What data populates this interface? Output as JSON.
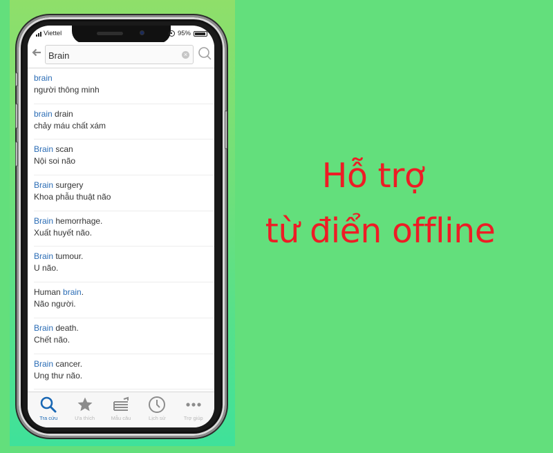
{
  "status_bar": {
    "carrier": "Viettel",
    "battery": "95%",
    "battery_level": 0.95
  },
  "search": {
    "value": "Brain",
    "placeholder": "",
    "back_icon": "arrow-left-icon",
    "clear_icon": "clear-circle-icon",
    "search_icon": "magnifier-icon"
  },
  "results": [
    {
      "pre": "",
      "hl": "brain",
      "post": "",
      "vi": "người thông minh"
    },
    {
      "pre": "",
      "hl": "brain",
      "post": " drain",
      "vi": "chảy máu chất xám"
    },
    {
      "pre": "",
      "hl": "Brain",
      "post": " scan",
      "vi": "Nội soi não"
    },
    {
      "pre": "",
      "hl": "Brain",
      "post": " surgery",
      "vi": "Khoa phẫu thuật não"
    },
    {
      "pre": "",
      "hl": "Brain",
      "post": " hemorrhage.",
      "vi": "Xuất huyết não."
    },
    {
      "pre": "",
      "hl": "Brain",
      "post": " tumour.",
      "vi": "U não."
    },
    {
      "pre": "Human ",
      "hl": "brain",
      "post": ".",
      "vi": "Não người."
    },
    {
      "pre": "",
      "hl": "Brain",
      "post": " death.",
      "vi": "Chết não."
    },
    {
      "pre": "",
      "hl": "Brain",
      "post": " cancer.",
      "vi": "Ung thư não."
    }
  ],
  "tabs": [
    {
      "label": "Tra cứu",
      "icon": "search-icon",
      "active": true
    },
    {
      "label": "Ưa thích",
      "icon": "star-icon",
      "active": false
    },
    {
      "label": "Mẫu câu",
      "icon": "sentences-icon",
      "active": false
    },
    {
      "label": "Lịch sử",
      "icon": "clock-icon",
      "active": false
    },
    {
      "label": "Trợ giúp",
      "icon": "more-icon",
      "active": false
    }
  ],
  "headline": {
    "line1": "Hỗ trợ",
    "line2": "từ điển offline"
  },
  "colors": {
    "background": "#63df7c",
    "headline": "#ee1c25",
    "highlight": "#2a6cb5",
    "tab_active": "#1a68b4"
  }
}
